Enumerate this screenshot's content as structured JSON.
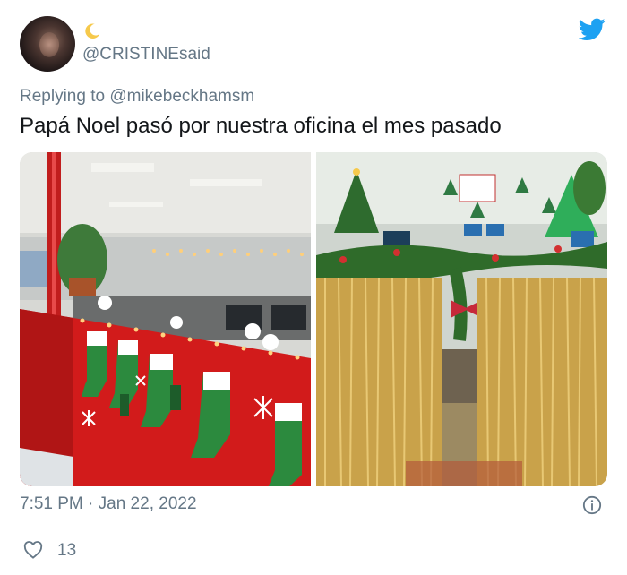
{
  "tweet": {
    "handle": "@CRISTINEsaid",
    "display_name_emoji": "🌙",
    "reply_prefix": "Replying to",
    "reply_mention": "@mikebeckhamsm",
    "text": "Papá Noel pasó por nuestra oficina el mes pasado",
    "timestamp": "7:51 PM · Jan 22, 2022",
    "like_count": "13"
  },
  "icons": {
    "brand": "twitter-bird-icon",
    "info": "info-icon",
    "like": "heart-icon",
    "moon": "crescent-moon-icon"
  },
  "colors": {
    "twitter_blue": "#1da1f2",
    "secondary_text": "#657786",
    "primary_text": "#14171a"
  }
}
